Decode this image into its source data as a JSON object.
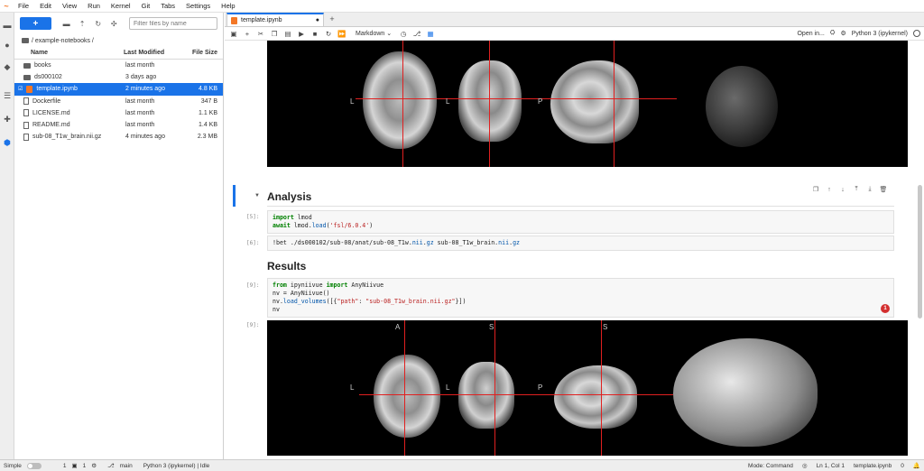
{
  "menubar": {
    "logo": "~",
    "items": [
      "File",
      "Edit",
      "View",
      "Run",
      "Kernel",
      "Git",
      "Tabs",
      "Settings",
      "Help"
    ]
  },
  "activity_icons": [
    "folder-icon",
    "running-icon",
    "git-icon",
    "toc-icon",
    "extensions-icon",
    "debugger-icon"
  ],
  "filebrowser": {
    "new_label": "+",
    "filter_placeholder": "Filter files by name",
    "breadcrumb": "/ example-notebooks /",
    "columns": {
      "name": "Name",
      "modified": "Last Modified",
      "size": "File Size"
    },
    "files": [
      {
        "name": "books",
        "modified": "last month",
        "size": "",
        "type": "folder"
      },
      {
        "name": "ds000102",
        "modified": "3 days ago",
        "size": "",
        "type": "folder"
      },
      {
        "name": "template.ipynb",
        "modified": "2 minutes ago",
        "size": "4.8 KB",
        "type": "notebook",
        "selected": true
      },
      {
        "name": "Dockerfile",
        "modified": "last month",
        "size": "347 B",
        "type": "file"
      },
      {
        "name": "LICENSE.md",
        "modified": "last month",
        "size": "1.1 KB",
        "type": "file"
      },
      {
        "name": "README.md",
        "modified": "last month",
        "size": "1.4 KB",
        "type": "file"
      },
      {
        "name": "sub-08_T1w_brain.nii.gz",
        "modified": "4 minutes ago",
        "size": "2.3 MB",
        "type": "file"
      }
    ]
  },
  "notebook": {
    "tab_title": "template.ipynb",
    "tab_add": "+",
    "cell_type": "Markdown",
    "open_in": "Open in...",
    "kernel_name": "Python 3 (ipykernel)",
    "orientation_labels": {
      "a": "A",
      "s": "S",
      "l": "L",
      "p": "P"
    },
    "heading_analysis": "Analysis",
    "heading_results": "Results",
    "prompt_5": "[5]:",
    "prompt_6": "[6]:",
    "prompt_9": "[9]:",
    "prompt_9_out": "[9]:",
    "prompt_empty": "[ ]:",
    "cell5": {
      "l1_kw": "import",
      "l1_rest": " lmod",
      "l2_kw": "await",
      "l2_a": " lmod.",
      "l2_fn": "load",
      "l2_b": "(",
      "l2_str": "'fsl/6.0.4'",
      "l2_c": ")"
    },
    "cell6": {
      "a": "!bet ./ds000102/sub-08/anat/sub-08_T1w.",
      "b": "nii",
      "c": ".",
      "d": "gz",
      "e": " sub-08_T1w_brain.",
      "f": "nii",
      "g": ".",
      "h": "gz"
    },
    "cell9": {
      "l1_kw": "from",
      "l1_a": " ipyniivue ",
      "l1_kw2": "import",
      "l1_b": " AnyNiivue",
      "l2": "nv = AnyNiivue()",
      "l3_a": "nv.",
      "l3_fn": "load_volumes",
      "l3_b": "([{",
      "l3_s1": "\"path\"",
      "l3_c": ": ",
      "l3_s2": "\"sub-08_T1w_brain.nii.gz\"",
      "l3_d": "}])",
      "l4": "nv"
    },
    "error_count": "1"
  },
  "statusbar": {
    "mode_label": "Simple",
    "count_a": "1",
    "count_b": "1",
    "branch": "main",
    "kernel_status": "Python 3 (ipykernel) | Idle",
    "mode": "Mode: Command",
    "cursor": "Ln 1, Col 1",
    "filename": "template.ipynb",
    "notifications": "0"
  }
}
